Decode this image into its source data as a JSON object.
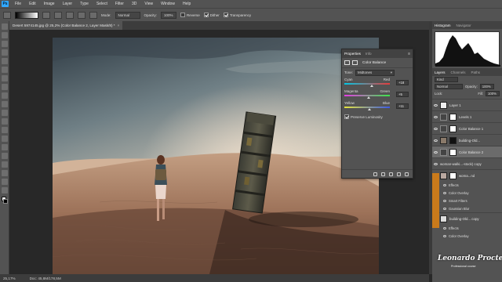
{
  "menubar": {
    "logo": "Ps",
    "items": [
      "File",
      "Edit",
      "Image",
      "Layer",
      "Type",
      "Select",
      "Filter",
      "3D",
      "View",
      "Window",
      "Help"
    ]
  },
  "options": {
    "mode_label": "Mode:",
    "mode_value": "Normal",
    "opacity_label": "Opacity:",
    "opacity_value": "100%",
    "reverse_label": "Reverse",
    "dither_label": "Dither",
    "transparency_label": "Transparency"
  },
  "document": {
    "tab_title": "Desert 5974145.jpg @ 25,2% (Color Balance 2, Layer Mask/8) *",
    "close": "×"
  },
  "status": {
    "zoom": "25,17%",
    "doc_size": "Doc: 45,8M/178,5M"
  },
  "properties": {
    "tabs": [
      "Properties",
      "Info"
    ],
    "panel_title": "Color Balance",
    "tone_label": "Tone:",
    "tone_value": "Midtones",
    "sliders": [
      {
        "left": "Cyan",
        "right": "Red",
        "value": "+18",
        "pct": 0.6
      },
      {
        "left": "Magenta",
        "right": "Green",
        "value": "+5",
        "pct": 0.53
      },
      {
        "left": "Yellow",
        "right": "Blue",
        "value": "+11",
        "pct": 0.56
      }
    ],
    "preserve_label": "Preserve Luminosity",
    "menu_icon": "≡"
  },
  "right": {
    "hist_tabs": [
      "Histogram",
      "Navigator"
    ],
    "layer_tabs": [
      "Layers",
      "Channels",
      "Paths"
    ],
    "kind_label": "Kind",
    "blend_mode": "Normal",
    "opacity_label": "Opacity:",
    "opacity_value": "100%",
    "lock_label": "Lock:",
    "fill_label": "Fill:",
    "fill_value": "100%",
    "layers": [
      {
        "name": "Layer 1"
      },
      {
        "name": "Levels 1"
      },
      {
        "name": "Color Balance 1"
      },
      {
        "name": "building-Old..."
      },
      {
        "name": "Color Balance 2"
      },
      {
        "name": "woman-walki...-stock) copy"
      },
      {
        "name": "woma...nd"
      }
    ],
    "sub_items": [
      "Effects",
      "Color Overlay",
      "Smart Filters",
      "Gaussian Blur"
    ],
    "layers2": [
      {
        "name": "building-Old... copy"
      }
    ],
    "sub_items2": [
      "Effects",
      "Color Overlay"
    ]
  },
  "watermark": {
    "name": "Leonardo Procter",
    "sub": "Professional course"
  }
}
